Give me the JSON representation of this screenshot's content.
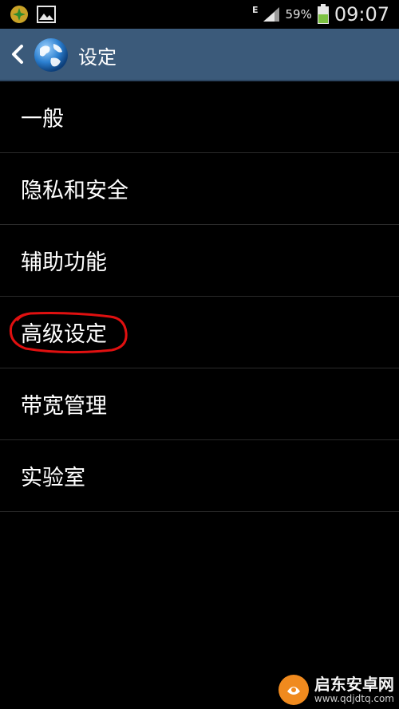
{
  "status_bar": {
    "network": "E",
    "battery_percent": "59%",
    "time": "09:07",
    "icons": [
      "app-notification-icon",
      "image-icon",
      "signal-icon",
      "battery-icon"
    ]
  },
  "action_bar": {
    "title": "设定",
    "icons": [
      "back-chevron-icon",
      "globe-icon"
    ],
    "color": "#3b5a7a"
  },
  "settings_list": {
    "items": [
      {
        "label": "一般"
      },
      {
        "label": "隐私和安全"
      },
      {
        "label": "辅助功能"
      },
      {
        "label": "高级设定"
      },
      {
        "label": "带宽管理"
      },
      {
        "label": "实验室"
      }
    ]
  },
  "annotation": {
    "highlighted_item": "高级设定",
    "color": "#e01010"
  },
  "watermark": {
    "name": "启东安卓网",
    "url": "www.qdjdtq.com"
  }
}
